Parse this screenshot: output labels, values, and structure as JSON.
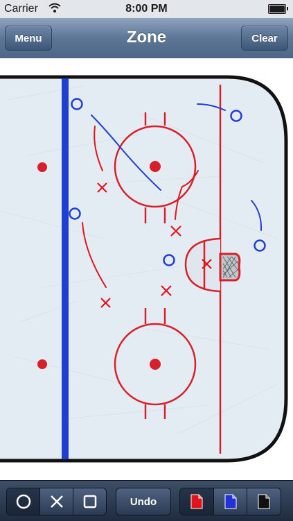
{
  "status_bar": {
    "carrier": "Carrier",
    "time": "8:00 PM"
  },
  "nav": {
    "title": "Zone",
    "menu_label": "Menu",
    "clear_label": "Clear"
  },
  "toolbar": {
    "undo_label": "Undo",
    "shape_tools": [
      {
        "name": "circle-tool",
        "icon": "circle-icon"
      },
      {
        "name": "x-tool",
        "icon": "x-icon"
      },
      {
        "name": "square-tool",
        "icon": "square-icon"
      }
    ],
    "color_tools": [
      {
        "name": "red-color",
        "color": "#e0141a",
        "selected": true
      },
      {
        "name": "blue-color",
        "color": "#2231d8",
        "selected": false
      },
      {
        "name": "black-color",
        "color": "#111111",
        "selected": false
      }
    ]
  },
  "colors": {
    "red": "#d8202a",
    "blue": "#1f3fd0",
    "ice": "#e4ecf3"
  }
}
